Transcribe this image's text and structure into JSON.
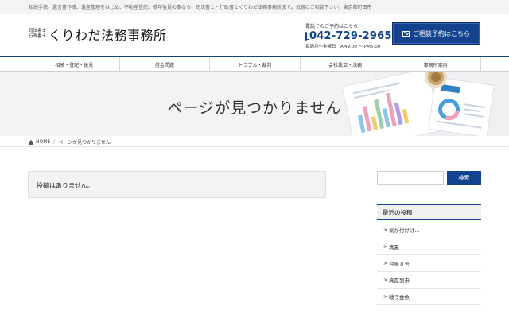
{
  "topbar": {
    "text": "相続手続、遺言書作成、遺産整理をはじめ、不動産登記、成年後見の事なら、司法書士・行政書士くりわだ法務事務所まで。気軽にご相談下さい。東京都町田市"
  },
  "logo": {
    "small_line1": "司法書士",
    "small_line2": "行政書士",
    "main": "くりわだ法務事務所"
  },
  "phone": {
    "label": "電話でのご予約はこちら",
    "number": "042-729-2965",
    "hours": "毎週月〜金曜日　AM9:00 〜 PM5:00"
  },
  "consult_button": {
    "label": "ご相談予約はこちら"
  },
  "nav": {
    "items": [
      {
        "label": "相続・登記・後見"
      },
      {
        "label": "借金問題"
      },
      {
        "label": "トラブル・裁判"
      },
      {
        "label": "会社設立・法務"
      },
      {
        "label": "事務所案内"
      }
    ]
  },
  "hero": {
    "title": "ページが見つかりません"
  },
  "breadcrumb": {
    "home": "HOME",
    "current": "ページが見つかりません"
  },
  "notice": {
    "text": "投稿はありません。"
  },
  "search": {
    "placeholder": "",
    "button": "検索"
  },
  "recent_posts": {
    "title": "最近の投稿",
    "items": [
      {
        "label": "気が付けば…"
      },
      {
        "label": "真夏"
      },
      {
        "label": "台風８号"
      },
      {
        "label": "真夏到来"
      },
      {
        "label": "戦う金魚"
      }
    ]
  },
  "colors": {
    "accent": "#13428e",
    "topbar_bg": "#f4f4f4",
    "hero_bg": "#f3f3f3"
  },
  "icons": {
    "phone": "mobile-phone-icon",
    "mail": "envelope-icon",
    "home": "home-icon",
    "arrow": "chevron-right-icon"
  }
}
